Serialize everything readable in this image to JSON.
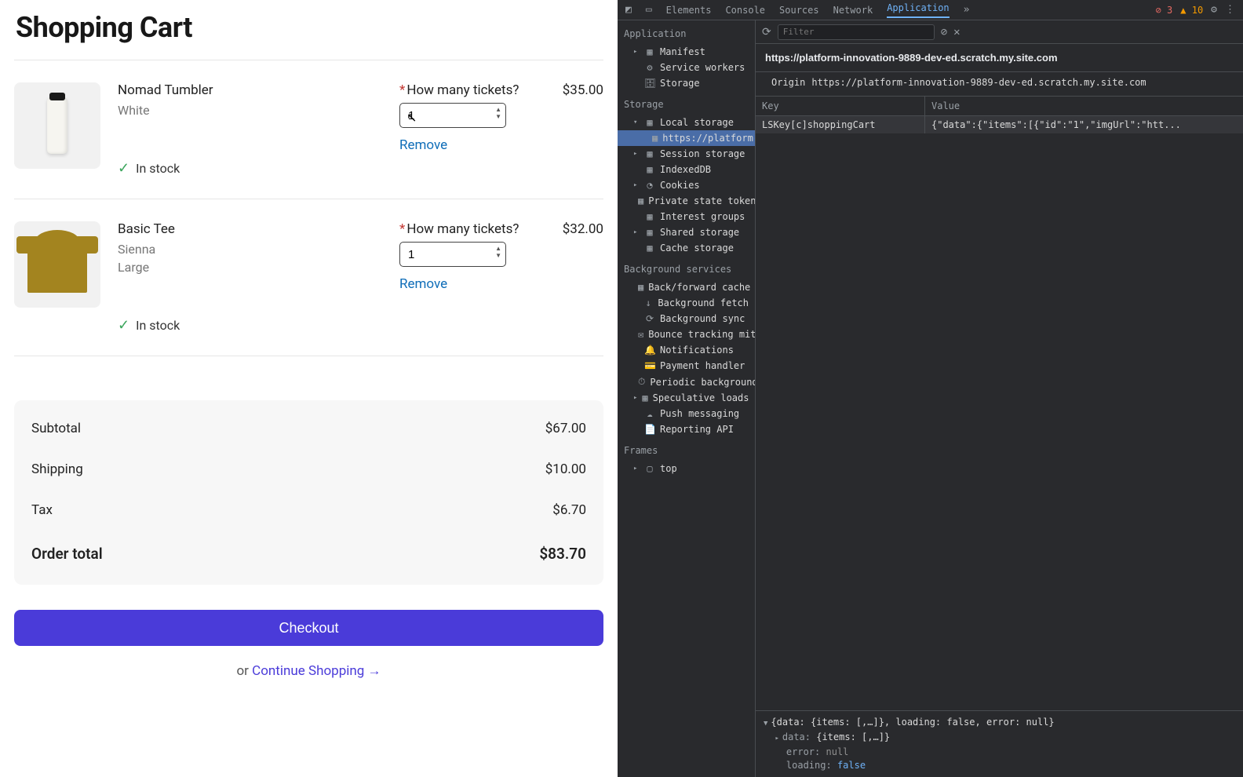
{
  "page_title": "Shopping Cart",
  "cart_items": [
    {
      "name": "Nomad Tumbler",
      "attrs": [
        "White"
      ],
      "price": "$35.00",
      "qty_label": "How many tickets?",
      "qty_value": "1",
      "remove": "Remove",
      "stock": "In stock"
    },
    {
      "name": "Basic Tee",
      "attrs": [
        "Sienna",
        "Large"
      ],
      "price": "$32.00",
      "qty_label": "How many tickets?",
      "qty_value": "1",
      "remove": "Remove",
      "stock": "In stock"
    }
  ],
  "summary": {
    "subtotal_label": "Subtotal",
    "subtotal": "$67.00",
    "shipping_label": "Shipping",
    "shipping": "$10.00",
    "tax_label": "Tax",
    "tax": "$6.70",
    "total_label": "Order total",
    "total": "$83.70"
  },
  "checkout": "Checkout",
  "or_text": "or  ",
  "continue_text": "Continue Shopping →",
  "devtools": {
    "tabs": [
      "Elements",
      "Console",
      "Sources",
      "Network",
      "Application"
    ],
    "errors": "3",
    "warnings": "10",
    "filter_placeholder": "Filter",
    "url": "https://platform-innovation-9889-dev-ed.scratch.my.site.com",
    "origin_label": "Origin",
    "origin": "https://platform-innovation-9889-dev-ed.scratch.my.site.com",
    "kv_key_header": "Key",
    "kv_value_header": "Value",
    "kv_key": "LSKey[c]shoppingCart",
    "kv_value": "{\"data\":{\"items\":[{\"id\":\"1\",\"imgUrl\":\"htt...",
    "sidebar": {
      "application": "Application",
      "manifest": "Manifest",
      "service_workers": "Service workers",
      "storage_item": "Storage",
      "storage_section": "Storage",
      "local_storage": "Local storage",
      "local_storage_url": "https://platform-innovatio",
      "session_storage": "Session storage",
      "indexeddb": "IndexedDB",
      "cookies": "Cookies",
      "private_tokens": "Private state tokens",
      "interest_groups": "Interest groups",
      "shared_storage": "Shared storage",
      "cache_storage": "Cache storage",
      "bg_section": "Background services",
      "bf_cache": "Back/forward cache",
      "bg_fetch": "Background fetch",
      "bg_sync": "Background sync",
      "bounce": "Bounce tracking mitigation",
      "notifications": "Notifications",
      "payment": "Payment handler",
      "periodic": "Periodic background sync",
      "speculative": "Speculative loads",
      "push": "Push messaging",
      "reporting": "Reporting API",
      "frames_section": "Frames",
      "top_frame": "top"
    },
    "console": {
      "l1": "{data: {items: [,…]}, loading: false, error: null}",
      "l2_k": "data:",
      "l2_v": "{items: [,…]}",
      "l3_k": "error:",
      "l3_v": "null",
      "l4_k": "loading:",
      "l4_v": "false"
    }
  }
}
